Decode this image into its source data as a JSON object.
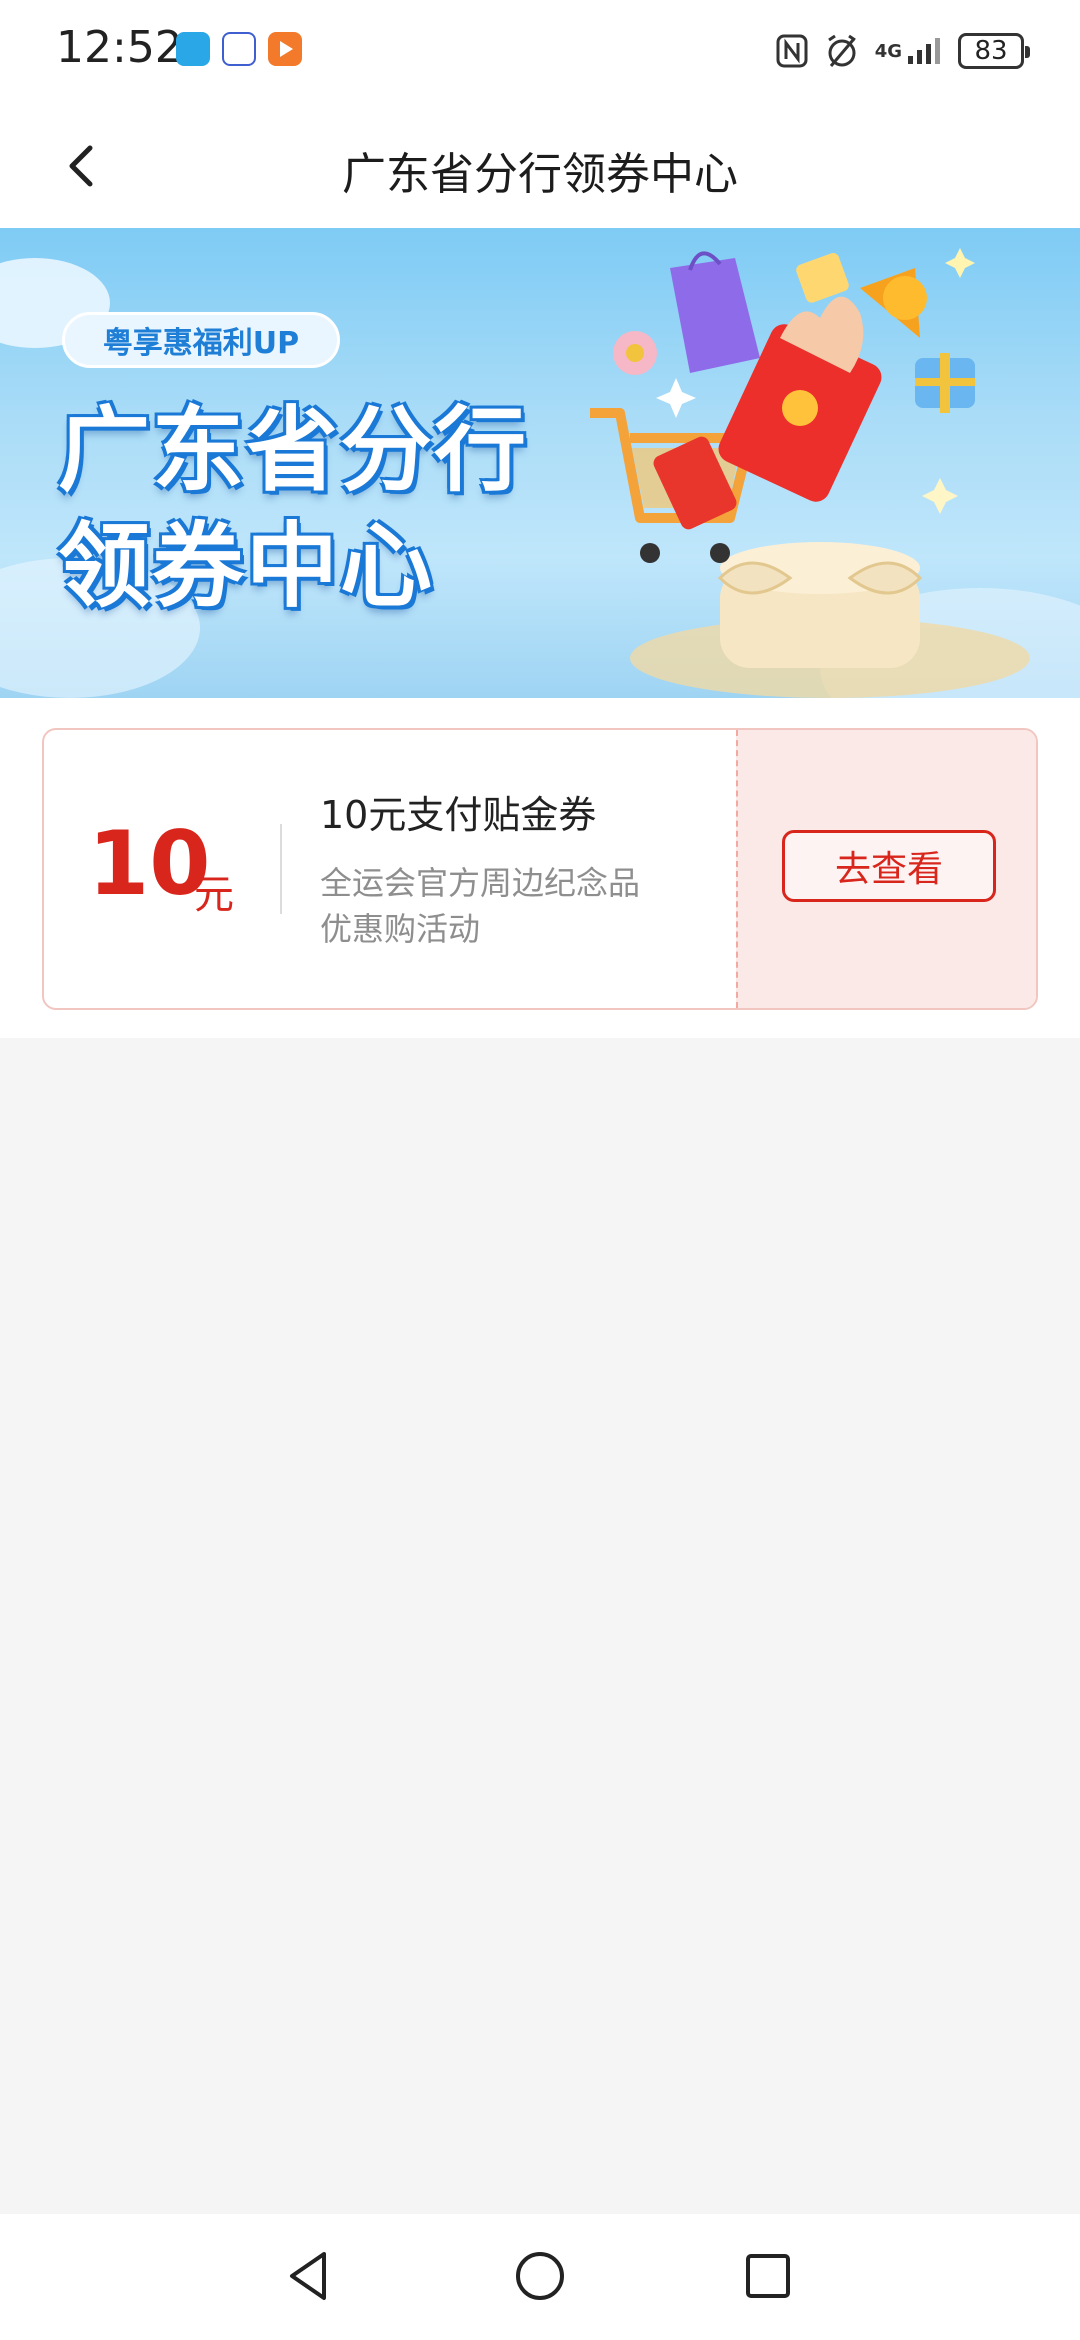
{
  "status_bar": {
    "time": "12:52",
    "network": "4G",
    "battery": "83"
  },
  "header": {
    "title": "广东省分行领券中心"
  },
  "banner": {
    "tag": "粤享惠福利UP",
    "title_line1": "广东省分行",
    "title_line2": "领券中心"
  },
  "coupon": {
    "amount": "10",
    "unit": "元",
    "title": "10元支付贴金券",
    "desc_line1": "全运会官方周边纪念品",
    "desc_line2": "优惠购活动",
    "button_label": "去查看"
  },
  "colors": {
    "accent_red": "#d8261c",
    "banner_blue": "#1a78d6"
  }
}
